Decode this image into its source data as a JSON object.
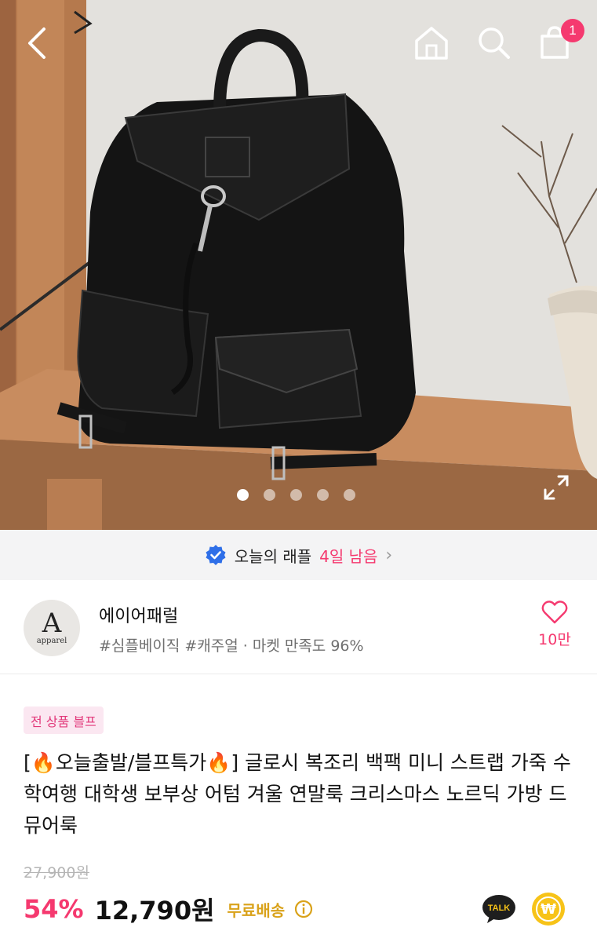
{
  "header": {
    "cart_count": "1",
    "icons": [
      "back-icon",
      "home-icon",
      "search-icon",
      "cart-icon"
    ]
  },
  "gallery": {
    "total_images": 5,
    "active_index": 1
  },
  "raffle": {
    "label": "오늘의 래플",
    "days_left": "4일 남음"
  },
  "store": {
    "logo_letter": "A",
    "logo_sub": "apparel",
    "name": "에이어패럴",
    "tags": "#심플베이직 #캐주얼 · 마켓 만족도 96%",
    "likes": "10만"
  },
  "product": {
    "badge": "전 상품 블프",
    "title": "[🔥오늘출발/블프특가🔥] 글로시 복조리 백팩 미니 스트랩 가죽 수학여행 대학생 보부상 어텀 겨울 연말룩 크리스마스 노르딕 가방 드뮤어룩",
    "original_price": "27,900원",
    "discount": "54%",
    "price": "12,790원",
    "shipping": "무료배송"
  },
  "actions": {
    "talk_label": "TALK",
    "won_symbol": "₩"
  },
  "colors": {
    "accent_pink": "#f5396f",
    "shipping_gold": "#d9a21a",
    "kakao_yellow": "#f7c318",
    "badge_bg": "#fbe7f1"
  }
}
